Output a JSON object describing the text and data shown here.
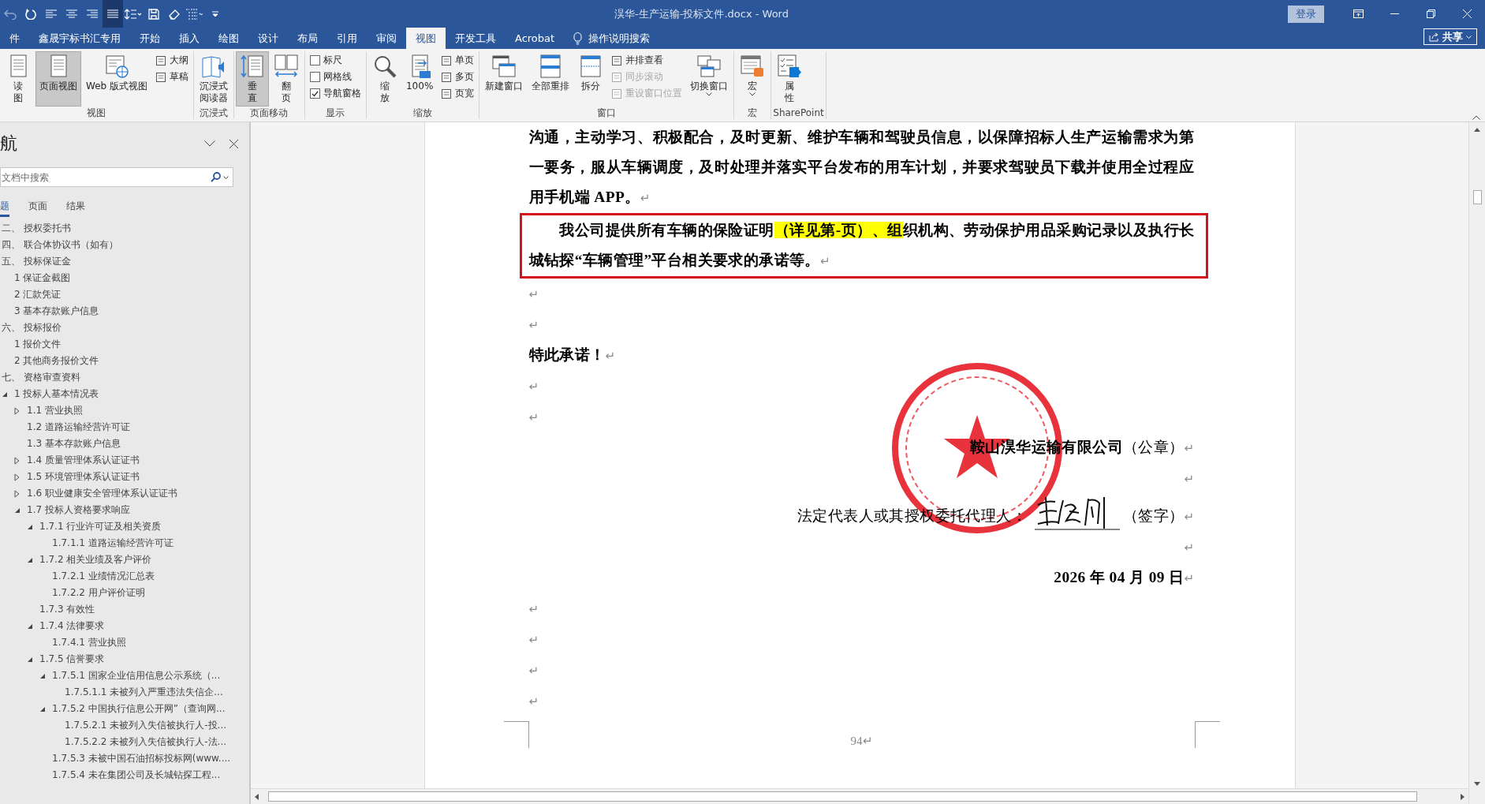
{
  "title_bar": {
    "title": "淏华-生产运输-投标文件.docx  -  Word",
    "login_button": "登录"
  },
  "quick_access": [
    {
      "kind": "undo",
      "pressed": false,
      "disabled": true
    },
    {
      "kind": "repeat",
      "pressed": false,
      "disabled": false
    },
    {
      "kind": "align-left",
      "pressed": false,
      "disabled": false
    },
    {
      "kind": "align-center",
      "pressed": false,
      "disabled": false
    },
    {
      "kind": "align-right",
      "pressed": false,
      "disabled": false
    },
    {
      "kind": "justify",
      "pressed": true,
      "disabled": false
    },
    {
      "kind": "line-spacing",
      "pressed": false,
      "disabled": false
    },
    {
      "kind": "save",
      "pressed": false,
      "disabled": false
    },
    {
      "kind": "eraser",
      "pressed": false,
      "disabled": false
    },
    {
      "kind": "list",
      "pressed": false,
      "disabled": false
    },
    {
      "kind": "customize",
      "pressed": false,
      "disabled": false
    }
  ],
  "ribbon_tabs": [
    {
      "label": "件",
      "selected": false
    },
    {
      "label": "鑫晟宇标书汇专用",
      "selected": false
    },
    {
      "label": "开始",
      "selected": false
    },
    {
      "label": "插入",
      "selected": false
    },
    {
      "label": "绘图",
      "selected": false
    },
    {
      "label": "设计",
      "selected": false
    },
    {
      "label": "布局",
      "selected": false
    },
    {
      "label": "引用",
      "selected": false
    },
    {
      "label": "审阅",
      "selected": false
    },
    {
      "label": "视图",
      "selected": true
    },
    {
      "label": "开发工具",
      "selected": false
    },
    {
      "label": "Acrobat",
      "selected": false
    }
  ],
  "tell_me": "操作说明搜索",
  "share_button": "共享",
  "ribbon_groups": [
    {
      "label": "视图",
      "columns": [
        {
          "kind": "large",
          "label": "读图",
          "wrap": true,
          "selected": false,
          "dropdown": false
        },
        {
          "kind": "large",
          "label": "页面视图",
          "wrap": false,
          "selected": true,
          "dropdown": false
        },
        {
          "kind": "large",
          "label": "Web 版式视图",
          "wrap": false,
          "selected": false,
          "dropdown": false
        },
        {
          "kind": "stack",
          "items": [
            {
              "kind": "small",
              "label": "大纲",
              "disabled": false
            },
            {
              "kind": "small",
              "label": "草稿",
              "disabled": false
            }
          ]
        }
      ]
    },
    {
      "label": "沉浸式",
      "columns": [
        {
          "kind": "large",
          "label": "沉浸式阅读器",
          "wrap": true,
          "selected": false,
          "dropdown": false
        }
      ]
    },
    {
      "label": "页面移动",
      "columns": [
        {
          "kind": "large",
          "label": "垂直",
          "wrap": true,
          "selected": true,
          "dropdown": false
        },
        {
          "kind": "large",
          "label": "翻页",
          "wrap": true,
          "selected": false,
          "dropdown": false
        }
      ]
    },
    {
      "label": "显示",
      "columns": [
        {
          "kind": "stack",
          "items": [
            {
              "kind": "check",
              "label": "标尺",
              "checked": false
            },
            {
              "kind": "check",
              "label": "网格线",
              "checked": false
            },
            {
              "kind": "check",
              "label": "导航窗格",
              "checked": true
            }
          ]
        }
      ]
    },
    {
      "label": "缩放",
      "columns": [
        {
          "kind": "large",
          "label": "缩放",
          "wrap": true,
          "selected": false,
          "dropdown": false
        },
        {
          "kind": "large",
          "label": "100%",
          "wrap": false,
          "selected": false,
          "dropdown": false
        },
        {
          "kind": "stack",
          "items": [
            {
              "kind": "small",
              "label": "单页",
              "disabled": false
            },
            {
              "kind": "small",
              "label": "多页",
              "disabled": false
            },
            {
              "kind": "small",
              "label": "页宽",
              "disabled": false
            }
          ]
        }
      ]
    },
    {
      "label": "窗口",
      "columns": [
        {
          "kind": "large",
          "label": "新建窗口",
          "wrap": false,
          "selected": false,
          "dropdown": false
        },
        {
          "kind": "large",
          "label": "全部重排",
          "wrap": false,
          "selected": false,
          "dropdown": false
        },
        {
          "kind": "large",
          "label": "拆分",
          "wrap": false,
          "selected": false,
          "dropdown": false
        },
        {
          "kind": "stack",
          "items": [
            {
              "kind": "small",
              "label": "并排查看",
              "disabled": false
            },
            {
              "kind": "small",
              "label": "同步滚动",
              "disabled": true
            },
            {
              "kind": "small",
              "label": "重设窗口位置",
              "disabled": true
            }
          ]
        },
        {
          "kind": "large",
          "label": "切换窗口",
          "wrap": false,
          "selected": false,
          "dropdown": true
        }
      ]
    },
    {
      "label": "宏",
      "columns": [
        {
          "kind": "large",
          "label": "宏",
          "selected": false,
          "dropdown": true
        }
      ]
    },
    {
      "label": "SharePoint",
      "columns": [
        {
          "kind": "large",
          "label": "属性",
          "wrap": true,
          "selected": false,
          "dropdown": false
        }
      ]
    }
  ],
  "navigation": {
    "title": "航",
    "search_placeholder": "文档中搜索",
    "tabs": [
      {
        "label": "题",
        "selected": true
      },
      {
        "label": "页面",
        "selected": false
      },
      {
        "label": "结果",
        "selected": false
      }
    ],
    "headings": [
      {
        "text": "二、 授权委托书"
      },
      {
        "text": "四、 联合体协议书（如有）"
      },
      {
        "text": "五、 投标保证金",
        "children": [
          {
            "text": "1 保证金截图"
          },
          {
            "text": "2 汇款凭证"
          },
          {
            "text": "3 基本存款账户信息"
          }
        ]
      },
      {
        "text": "六、 投标报价",
        "children": [
          {
            "text": "1 报价文件"
          },
          {
            "text": "2 其他商务报价文件"
          }
        ]
      },
      {
        "text": "七、 资格审查资料",
        "children": [
          {
            "text": "1 投标人基本情况表",
            "expanded": true,
            "children": [
              {
                "text": "1.1 营业执照",
                "expanded": false
              },
              {
                "text": "1.2 道路运输经营许可证"
              },
              {
                "text": "1.3 基本存款账户信息"
              },
              {
                "text": "1.4 质量管理体系认证证书",
                "expanded": false
              },
              {
                "text": "1.5 环境管理体系认证证书",
                "expanded": false
              },
              {
                "text": "1.6 职业健康安全管理体系认证证书",
                "expanded": false
              },
              {
                "text": "1.7 投标人资格要求响应",
                "expanded": true,
                "children": [
                  {
                    "text": "1.7.1 行业许可证及相关资质",
                    "expanded": true,
                    "children": [
                      {
                        "text": "1.7.1.1 道路运输经营许可证"
                      }
                    ]
                  },
                  {
                    "text": "1.7.2 相关业绩及客户评价",
                    "expanded": true,
                    "children": [
                      {
                        "text": "1.7.2.1 业绩情况汇总表"
                      },
                      {
                        "text": "1.7.2.2 用户评价证明"
                      }
                    ]
                  },
                  {
                    "text": "1.7.3 有效性"
                  },
                  {
                    "text": "1.7.4 法律要求",
                    "expanded": true,
                    "children": [
                      {
                        "text": "1.7.4.1 营业执照"
                      }
                    ]
                  },
                  {
                    "text": "1.7.5 信誉要求",
                    "expanded": true,
                    "children": [
                      {
                        "text": "1.7.5.1 国家企业信用信息公示系统（...",
                        "expanded": true,
                        "children": [
                          {
                            "text": "1.7.5.1.1 未被列入严重违法失信企..."
                          }
                        ]
                      },
                      {
                        "text": "1.7.5.2 中国执行信息公开网”（查询网...",
                        "expanded": true,
                        "children": [
                          {
                            "text": "1.7.5.2.1 未被列入失信被执行人-投..."
                          },
                          {
                            "text": "1.7.5.2.2 未被列入失信被执行人-法..."
                          }
                        ]
                      },
                      {
                        "text": "1.7.5.3 未被中国石油招标投标网(www...."
                      },
                      {
                        "text": "1.7.5.4 未在集团公司及长城钻探工程..."
                      }
                    ]
                  }
                ]
              }
            ]
          }
        ]
      }
    ]
  },
  "document": {
    "paragraphs": [
      {
        "kind": "text",
        "right_aligned": false,
        "bold": true,
        "boxed": false,
        "indent": false,
        "segments": [
          {
            "text": "沟通，主动学习、积极配合，及时更新、维护车辆和驾驶员信息，以保障招标人生产运输需求为第一要务，服从车辆调度，及时处理并落实平台发布的用车计划，并要求驾驶员下载并使用全过程应用手机端 APP。",
            "highlighted": false
          }
        ],
        "mark": "↵"
      },
      {
        "kind": "text",
        "right_aligned": false,
        "bold": true,
        "boxed": true,
        "indent": true,
        "segments": [
          {
            "text": "我公司提供所有车辆的保险证明",
            "highlighted": false
          },
          {
            "text": "（详见第-页）、组",
            "highlighted": true
          },
          {
            "text": "织机构、劳动保护用品采购记录以及执行长城钻探“车辆管理”平台相关要求的承诺等。",
            "highlighted": false
          }
        ],
        "mark": "↵"
      },
      {
        "kind": "empty",
        "right_aligned": false,
        "mark": "↵"
      },
      {
        "kind": "empty",
        "right_aligned": false,
        "mark": "↵"
      },
      {
        "kind": "text",
        "right_aligned": false,
        "bold": true,
        "boxed": false,
        "indent": false,
        "segments": [
          {
            "text": "特此承诺！",
            "highlighted": false
          }
        ],
        "mark": "↵"
      },
      {
        "kind": "empty",
        "right_aligned": false,
        "mark": "↵"
      },
      {
        "kind": "empty",
        "right_aligned": false,
        "mark": "↵"
      },
      {
        "kind": "rich",
        "right_aligned": true,
        "text": "**鞍山淏华运输有限公司**（公章）",
        "mark": "↵"
      },
      {
        "kind": "empty",
        "right_aligned": true,
        "mark": "↵"
      },
      {
        "kind": "signature",
        "right_aligned": true,
        "label": "法定代表人或其授权委托代理人：",
        "suffix": "（签字）",
        "mark": "↵"
      },
      {
        "kind": "empty",
        "right_aligned": true,
        "mark": "↵"
      },
      {
        "kind": "text",
        "right_aligned": true,
        "bold": true,
        "boxed": false,
        "indent": false,
        "segments": [
          {
            "text": "2026 年 04 月 09 日",
            "highlighted": false
          }
        ],
        "mark": "↵"
      },
      {
        "kind": "empty",
        "right_aligned": false,
        "mark": "↵"
      },
      {
        "kind": "empty",
        "right_aligned": false,
        "mark": "↵"
      },
      {
        "kind": "empty",
        "right_aligned": false,
        "mark": "↵"
      },
      {
        "kind": "empty",
        "right_aligned": false,
        "mark": "↵"
      }
    ],
    "page_number": "94",
    "page_number_mark": "↵"
  }
}
